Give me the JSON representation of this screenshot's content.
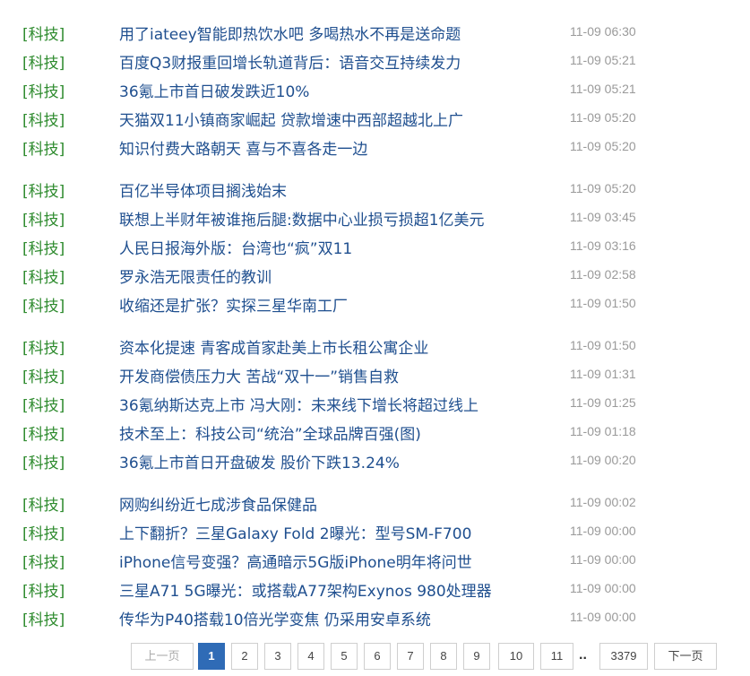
{
  "news": [
    [
      {
        "category": "[科技]",
        "title": "用了iateey智能即热饮水吧 多喝热水不再是送命题",
        "time": "11-09 06:30"
      },
      {
        "category": "[科技]",
        "title": "百度Q3财报重回增长轨道背后：语音交互持续发力",
        "time": "11-09 05:21"
      },
      {
        "category": "[科技]",
        "title": "36氪上市首日破发跌近10%",
        "time": "11-09 05:21"
      },
      {
        "category": "[科技]",
        "title": "天猫双11小镇商家崛起 贷款增速中西部超越北上广",
        "time": "11-09 05:20"
      },
      {
        "category": "[科技]",
        "title": "知识付费大路朝天 喜与不喜各走一边",
        "time": "11-09 05:20"
      }
    ],
    [
      {
        "category": "[科技]",
        "title": "百亿半导体项目搁浅始末",
        "time": "11-09 05:20"
      },
      {
        "category": "[科技]",
        "title": "联想上半财年被谁拖后腿:数据中心业损亏损超1亿美元",
        "time": "11-09 03:45"
      },
      {
        "category": "[科技]",
        "title": "人民日报海外版：台湾也“疯”双11",
        "time": "11-09 03:16"
      },
      {
        "category": "[科技]",
        "title": "罗永浩无限责任的教训",
        "time": "11-09 02:58"
      },
      {
        "category": "[科技]",
        "title": "收缩还是扩张？实探三星华南工厂",
        "time": "11-09 01:50"
      }
    ],
    [
      {
        "category": "[科技]",
        "title": "资本化提速 青客成首家赴美上市长租公寓企业",
        "time": "11-09 01:50"
      },
      {
        "category": "[科技]",
        "title": "开发商偿债压力大 苦战“双十一”销售自救",
        "time": "11-09 01:31"
      },
      {
        "category": "[科技]",
        "title": "36氪纳斯达克上市 冯大刚：未来线下增长将超过线上",
        "time": "11-09 01:25"
      },
      {
        "category": "[科技]",
        "title": "技术至上：科技公司“统治”全球品牌百强(图)",
        "time": "11-09 01:18"
      },
      {
        "category": "[科技]",
        "title": "36氪上市首日开盘破发 股价下跌13.24%",
        "time": "11-09 00:20"
      }
    ],
    [
      {
        "category": "[科技]",
        "title": "网购纠纷近七成涉食品保健品",
        "time": "11-09 00:02"
      },
      {
        "category": "[科技]",
        "title": "上下翻折？三星Galaxy Fold 2曝光：型号SM-F700",
        "time": "11-09 00:00"
      },
      {
        "category": "[科技]",
        "title": "iPhone信号变强？高通暗示5G版iPhone明年将问世",
        "time": "11-09 00:00"
      },
      {
        "category": "[科技]",
        "title": "三星A71 5G曝光：或搭载A77架构Exynos 980处理器",
        "time": "11-09 00:00"
      },
      {
        "category": "[科技]",
        "title": "传华为P40搭载10倍光学变焦 仍采用安卓系统",
        "time": "11-09 00:00"
      }
    ]
  ],
  "pagination": {
    "prev": "上一页",
    "pages": [
      "1",
      "2",
      "3",
      "4",
      "5",
      "6",
      "7",
      "8",
      "9",
      "10",
      "11"
    ],
    "current": "1",
    "ellipsis": "..",
    "last": "3379",
    "next": "下一页"
  },
  "colors": {
    "category": "#2e8b2e",
    "title": "#1f4f8f",
    "time": "#9a9a9a",
    "active_page": "#2f6bb6"
  }
}
